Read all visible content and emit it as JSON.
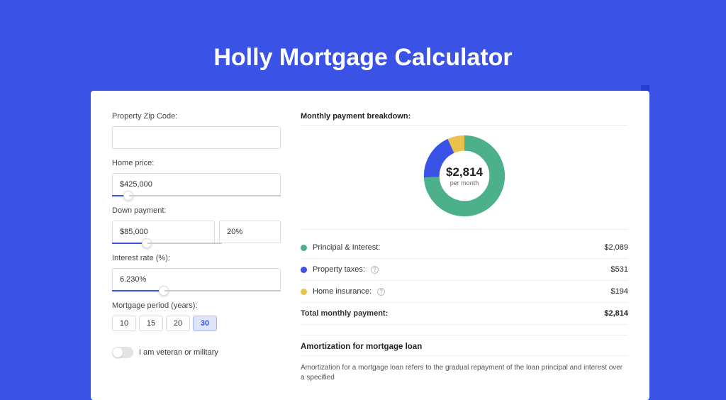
{
  "page_title": "Holly Mortgage Calculator",
  "form": {
    "zip_label": "Property Zip Code:",
    "zip_value": "",
    "home_price_label": "Home price:",
    "home_price_value": "$425,000",
    "down_payment_label": "Down payment:",
    "down_payment_amount": "$85,000",
    "down_payment_percent": "20%",
    "interest_label": "Interest rate (%):",
    "interest_value": "6.230%",
    "period_label": "Mortgage period (years):",
    "period_options": [
      "10",
      "15",
      "20",
      "30"
    ],
    "period_selected": "30",
    "veteran_label": "I am veteran or military",
    "veteran_on": false
  },
  "breakdown": {
    "title": "Monthly payment breakdown:",
    "center_amount": "$2,814",
    "center_sub": "per month",
    "items": [
      {
        "label": "Principal & Interest:",
        "value": "$2,089",
        "color": "g",
        "info": false
      },
      {
        "label": "Property taxes:",
        "value": "$531",
        "color": "b",
        "info": true
      },
      {
        "label": "Home insurance:",
        "value": "$194",
        "color": "y",
        "info": true
      }
    ],
    "total_label": "Total monthly payment:",
    "total_value": "$2,814"
  },
  "amort": {
    "title": "Amortization for mortgage loan",
    "body": "Amortization for a mortgage loan refers to the gradual repayment of the loan principal and interest over a specified"
  },
  "chart_data": {
    "type": "pie",
    "title": "Monthly payment breakdown",
    "series": [
      {
        "name": "Principal & Interest",
        "value": 2089,
        "color": "#4cb08a"
      },
      {
        "name": "Property taxes",
        "value": 531,
        "color": "#3a53e6"
      },
      {
        "name": "Home insurance",
        "value": 194,
        "color": "#eac14c"
      }
    ],
    "total": 2814,
    "center_label": "$2,814 per month"
  }
}
